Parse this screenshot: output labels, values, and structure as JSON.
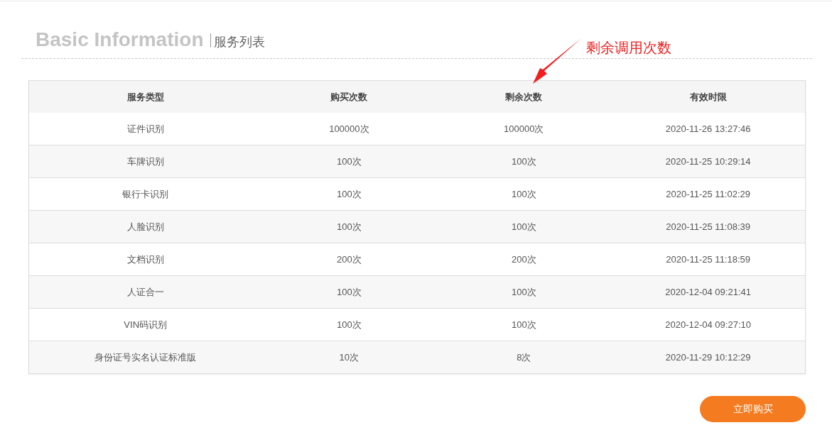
{
  "heading": {
    "title": "Basic Information",
    "subtitle": "服务列表"
  },
  "annotation": {
    "text": "剩余调用次数"
  },
  "table": {
    "columns": [
      "服务类型",
      "购买次数",
      "剩余次数",
      "有效时限"
    ],
    "rows": [
      [
        "证件识别",
        "100000次",
        "100000次",
        "2020-11-26 13:27:46"
      ],
      [
        "车牌识别",
        "100次",
        "100次",
        "2020-11-25 10:29:14"
      ],
      [
        "银行卡识别",
        "100次",
        "100次",
        "2020-11-25 11:02:29"
      ],
      [
        "人脸识别",
        "100次",
        "100次",
        "2020-11-25 11:08:39"
      ],
      [
        "文档识别",
        "200次",
        "200次",
        "2020-11-25 11:18:59"
      ],
      [
        "人证合一",
        "100次",
        "100次",
        "2020-12-04 09:21:41"
      ],
      [
        "VIN码识别",
        "100次",
        "100次",
        "2020-12-04 09:27:10"
      ],
      [
        "身份证号实名认证标准版",
        "10次",
        "8次",
        "2020-11-29 10:12:29"
      ]
    ]
  },
  "buy_button": "立即购买"
}
